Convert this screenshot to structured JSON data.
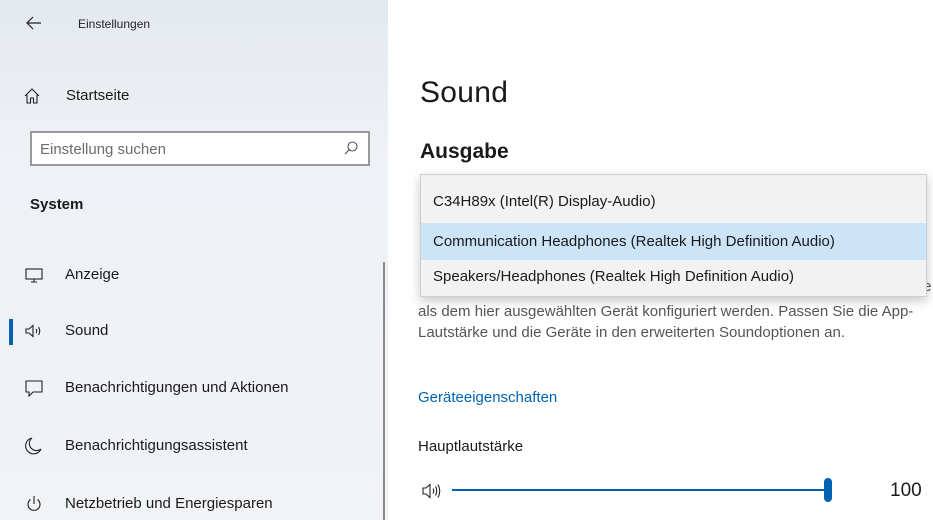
{
  "window": {
    "title": "Einstellungen",
    "back_icon": "arrow-left-icon"
  },
  "sidebar": {
    "home_label": "Startseite",
    "search": {
      "placeholder": "Einstellung suchen",
      "value": ""
    },
    "section_title": "System",
    "items": [
      {
        "label": "Anzeige",
        "icon": "monitor-icon",
        "active": false
      },
      {
        "label": "Sound",
        "icon": "speaker-icon",
        "active": true
      },
      {
        "label": "Benachrichtigungen und Aktionen",
        "icon": "notification-icon",
        "active": false
      },
      {
        "label": "Benachrichtigungsassistent",
        "icon": "moon-icon",
        "active": false
      },
      {
        "label": "Netzbetrieb und Energiesparen",
        "icon": "power-icon",
        "active": false
      }
    ]
  },
  "main": {
    "page_title": "Sound",
    "section": "Ausgabe",
    "description_tail": "te",
    "description": "als dem hier ausgewählten Gerät konfiguriert werden. Passen Sie die App-Lautstärke und die Geräte in den erweiterten Soundoptionen an.",
    "device_properties_link": "Geräteeigenschaften",
    "volume_label": "Hauptlautstärke",
    "volume_value": "100",
    "volume_fraction": 1.0
  },
  "dropdown": {
    "options": [
      "C34H89x (Intel(R) Display-Audio)",
      "Communication Headphones (Realtek High Definition Audio)",
      "Speakers/Headphones (Realtek High Definition Audio)"
    ],
    "selected_index": 1
  },
  "colors": {
    "accent": "#0063b1",
    "selection": "#cce4f7",
    "link": "#0063b1"
  }
}
